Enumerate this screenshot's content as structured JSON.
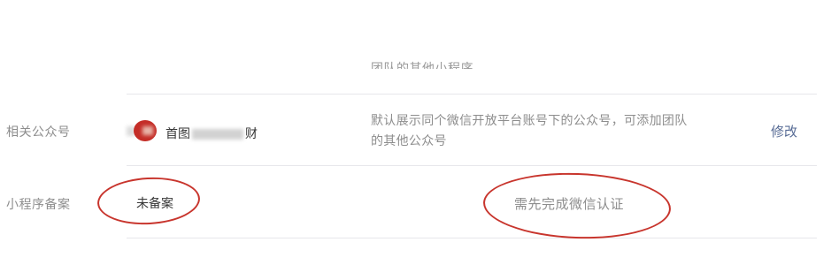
{
  "top_row": {
    "desc_tail": "团队的其他小程序"
  },
  "related_accounts": {
    "label": "相关公众号",
    "account_name_start": "首图",
    "account_name_end": "财",
    "description": "默认展示同个微信开放平台账号下的公众号，可添加团队的其他公众号",
    "action": "修改"
  },
  "miniprogram_filing": {
    "label": "小程序备案",
    "status": "未备案",
    "requirement": "需先完成微信认证"
  },
  "colors": {
    "link": "#576b95",
    "annotation": "#c8352d",
    "avatar": "#c42d27"
  }
}
